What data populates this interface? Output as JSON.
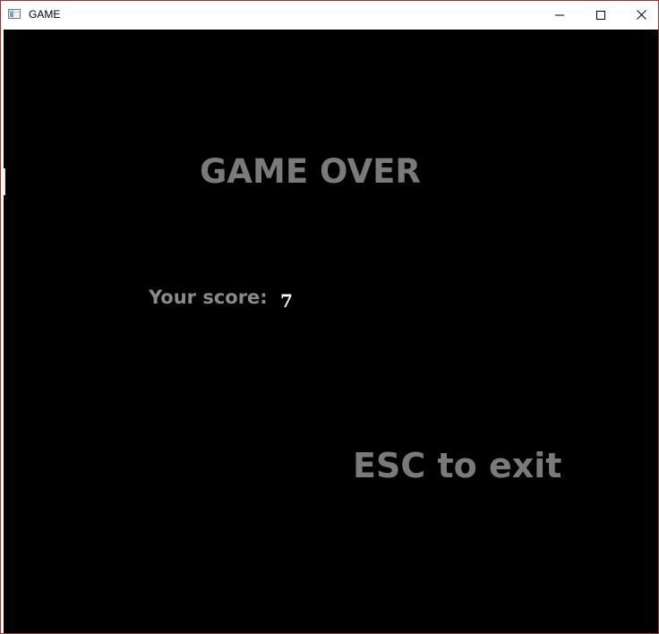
{
  "window": {
    "title": "GAME",
    "icon": "app-window-icon",
    "controls": {
      "minimize_icon": "minimize-icon",
      "maximize_icon": "maximize-icon",
      "close_icon": "close-icon"
    },
    "border_color": "#a0342f"
  },
  "game": {
    "background_color": "#000000",
    "heading": "GAME OVER",
    "score_label": "Your score:",
    "score_value": "7",
    "exit_hint": "ESC to exit",
    "text_color": "#7a7a7a",
    "score_value_color": "#ffffff"
  }
}
